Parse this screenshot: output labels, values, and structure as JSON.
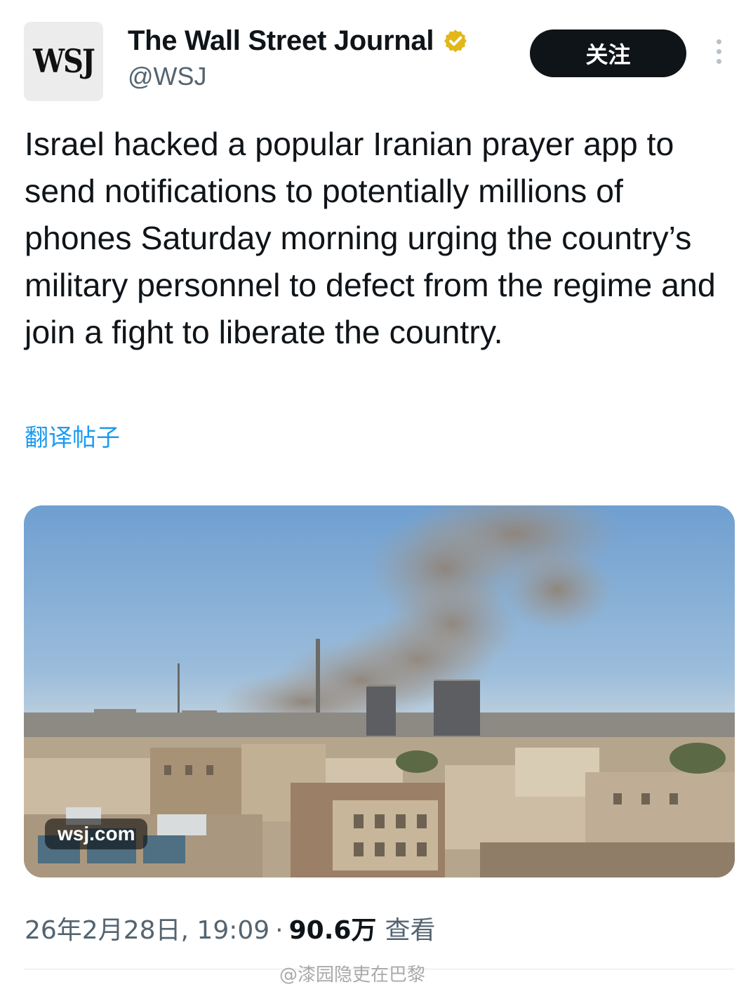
{
  "account": {
    "avatar_text": "WSJ",
    "name": "The Wall Street Journal",
    "handle": "@WSJ",
    "verified_badge_color": "#e2b719"
  },
  "follow_button_label": "关注",
  "more_icon": "more-vertical-icon",
  "tweet": {
    "text": "Israel hacked a popular Iranian prayer app to send notifications to potentially millions of phones Saturday morning urging the country’s military personnel to defect from the regime and join a fight to liberate the country.",
    "translate_link": "翻译帖子",
    "media_caption": "wsj.com"
  },
  "meta": {
    "date_time": "26年2月28日, 19:09",
    "separator": "·",
    "views_count": "90.6万",
    "views_label": "查看"
  },
  "watermark": "@漆园隐吏在巴黎",
  "colors": {
    "link": "#1d9bf0",
    "button_bg": "#0f1419",
    "secondary_text": "#536471"
  }
}
